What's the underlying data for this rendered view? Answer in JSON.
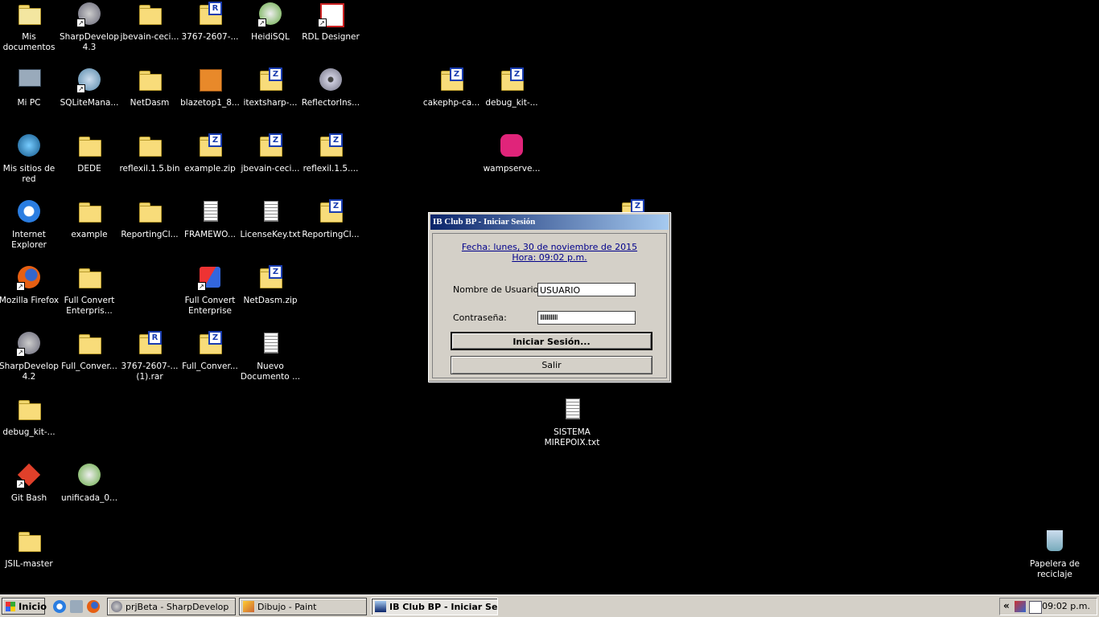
{
  "desktop_icons": {
    "mis_documentos": "Mis documentos",
    "sharpdevelop_43": "SharpDevelop 4.3",
    "jbevain1": "jbevain-ceci...",
    "r3767_a": "3767-2607-...",
    "heidisql": "HeidiSQL",
    "rdl_designer": "RDL Designer",
    "mi_pc": "Mi PC",
    "sqlite": "SQLiteMana...",
    "netdasm": "NetDasm",
    "blazetop": "blazetop1_8...",
    "itextsharp": "itextsharp-...",
    "reflectorins": "ReflectorIns...",
    "cakephp": "cakephp-ca...",
    "debug_kit_a": "debug_kit-...",
    "mis_sitios": "Mis sitios de red",
    "dede": "DEDE",
    "reflexil_bin": "reflexil.1.5.bin",
    "example_zip": "example.zip",
    "jbevain2": "jbevain-ceci...",
    "reflexil_zip": "reflexil.1.5....",
    "wampserver": "wampserve...",
    "ie": "Internet Explorer",
    "example": "example",
    "reportingcl_a": "ReportingCl...",
    "framewo": "FRAMEWO...",
    "licensekey": "LicenseKey.txt",
    "reportingcl_b": "ReportingCl...",
    "firefox": "Mozilla Firefox",
    "fullconvert_ent_folder": "Full Convert Enterpris...",
    "fullconvert_ent": "Full Convert Enterprise",
    "netdasm_zip": "NetDasm.zip",
    "sharpdevelop_42": "SharpDevelop 4.2",
    "full_conver_a": "Full_Conver...",
    "r3767_b": "3767-2607-... (1).rar",
    "full_conver_b": "Full_Conver...",
    "nuevo_doc": "Nuevo Documento ...",
    "debug_kit_b": "debug_kit-...",
    "sistema": "SISTEMA MIREPOIX.txt",
    "git_bash": "Git Bash",
    "unificada": "unificada_0...",
    "jsil": "JSIL-master",
    "papelera": "Papelera de reciclaje"
  },
  "dialog": {
    "title": "IB Club BP - Iniciar Sesión",
    "fecha": "Fecha: lunes, 30 de noviembre de 2015",
    "hora": "Hora: 09:02 p.m.",
    "user_label": "Nombre de Usuario:",
    "user_value": "USUARIO",
    "pass_label": "Contraseña:",
    "pass_value": "IIIIIIIIIIIII",
    "login_button": "Iniciar Sesión...",
    "exit_button": "Salir"
  },
  "taskbar": {
    "start": "Inicio",
    "tasks": [
      "prjBeta - SharpDevelop",
      "Dibujo - Paint",
      "IB Club BP - Iniciar Se..."
    ],
    "tray_toggle": "«",
    "clock": "09:02 p.m."
  }
}
